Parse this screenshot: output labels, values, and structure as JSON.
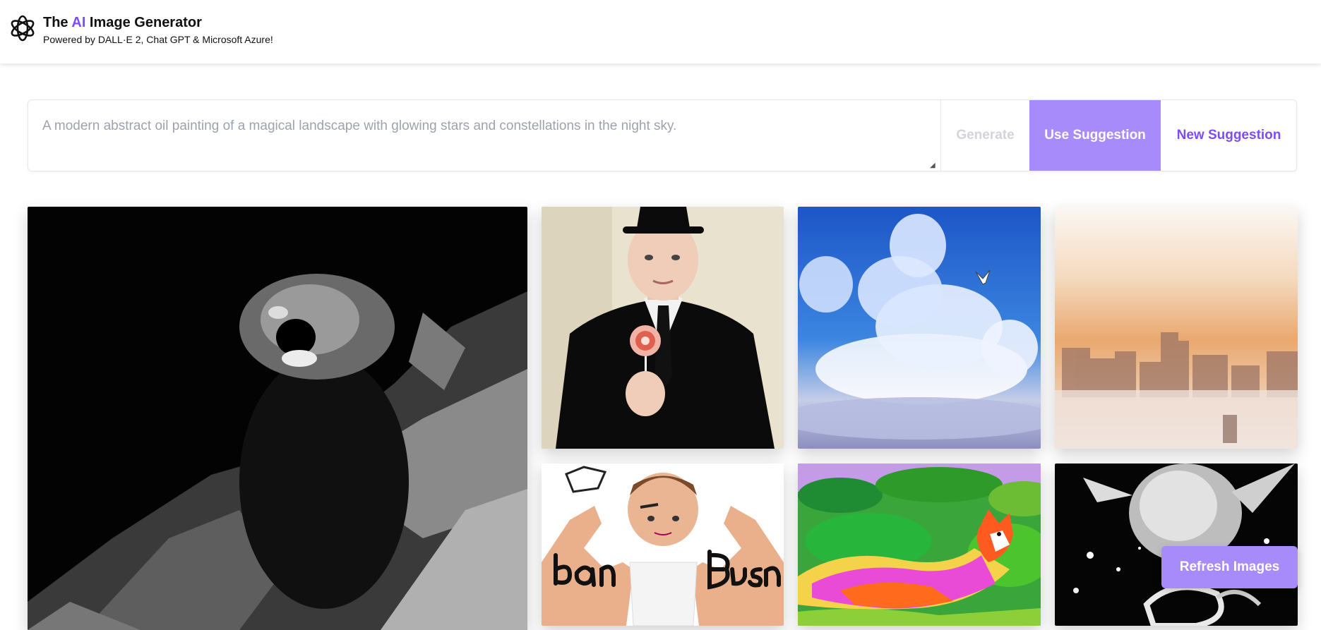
{
  "header": {
    "title_prefix": "The ",
    "title_accent": "AI",
    "title_suffix": " Image Generator",
    "subtitle": "Powered by DALL·E 2, Chat GPT & Microsoft Azure!",
    "logo_icon": "openai-logo-icon"
  },
  "prompt": {
    "placeholder": "A modern abstract oil painting of a magical landscape with glowing stars and constellations in the night sky.",
    "value": "",
    "generate_label": "Generate",
    "use_suggestion_label": "Use Suggestion",
    "new_suggestion_label": "New Suggestion"
  },
  "gallery": {
    "refresh_label": "Refresh Images"
  },
  "colors": {
    "accent": "#7c4dff",
    "accent_light": "#a78bfa",
    "disabled_text": "#d1d5db",
    "placeholder_text": "#9ca3af"
  }
}
